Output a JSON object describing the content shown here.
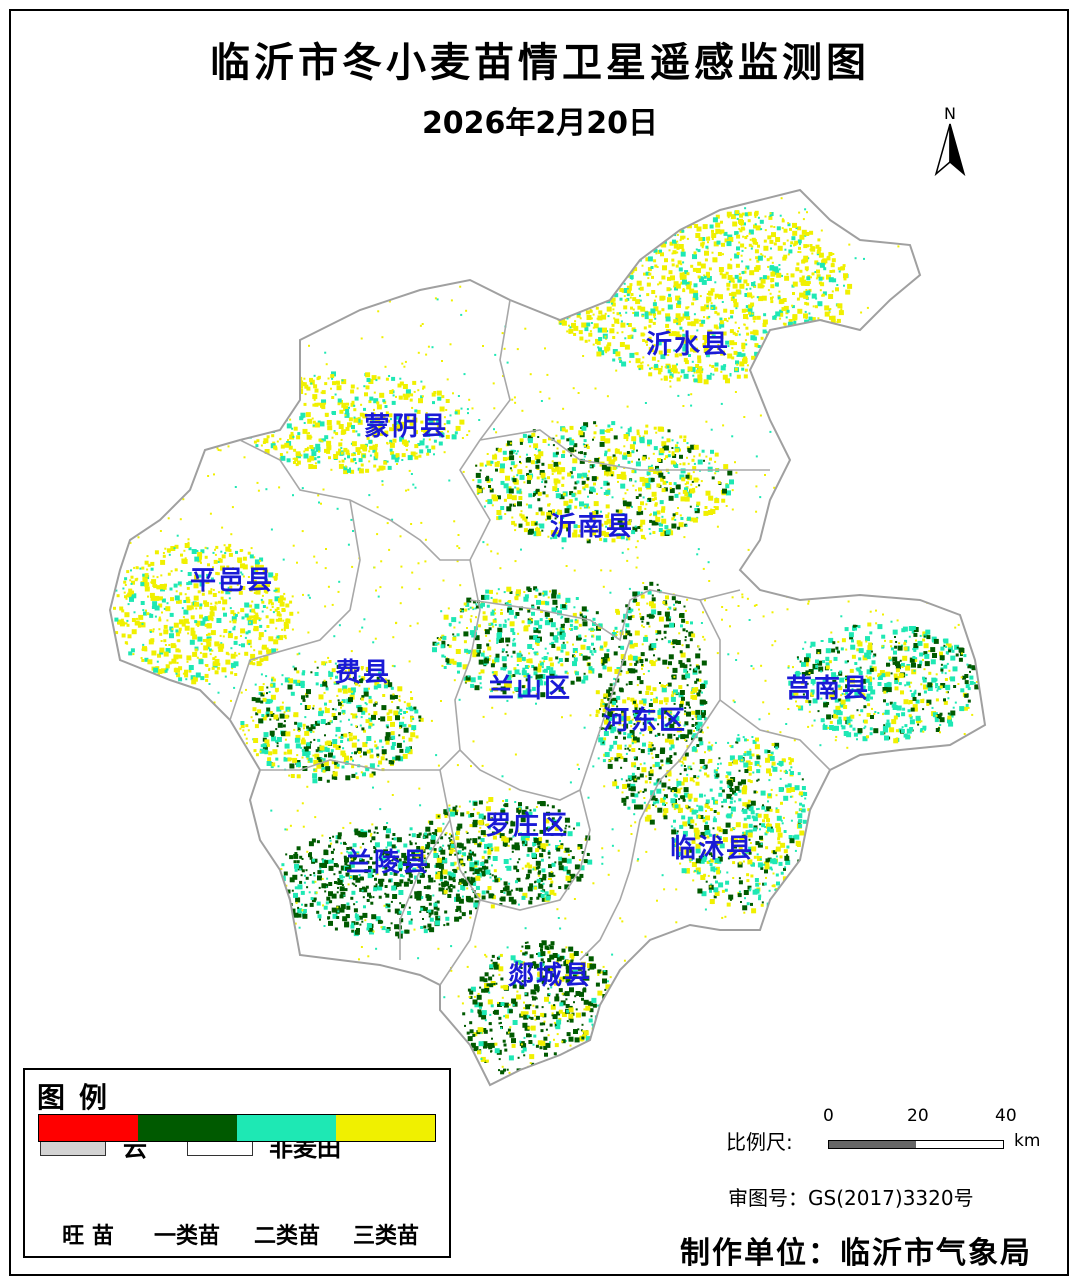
{
  "title": "临沂市冬小麦苗情卫星遥感监测图",
  "date": "2026年2月20日",
  "north_label": "N",
  "counties": [
    {
      "name": "沂水县"
    },
    {
      "name": "蒙阴县"
    },
    {
      "name": "沂南县"
    },
    {
      "name": "平邑县"
    },
    {
      "name": "费县"
    },
    {
      "name": "兰山区"
    },
    {
      "name": "莒南县"
    },
    {
      "name": "河东区"
    },
    {
      "name": "罗庄区"
    },
    {
      "name": "临沭县"
    },
    {
      "name": "兰陵县"
    },
    {
      "name": "郯城县"
    }
  ],
  "legend": {
    "title": "图例",
    "cloud_label": "云",
    "cloud_color": "#d3d3d3",
    "nonwheat_label": "非麦田",
    "nonwheat_color": "#ffffff",
    "classes": [
      {
        "label": "旺 苗",
        "color": "#ff0000"
      },
      {
        "label": "一类苗",
        "color": "#005a00"
      },
      {
        "label": "二类苗",
        "color": "#1ee8b4"
      },
      {
        "label": "三类苗",
        "color": "#f0f000"
      }
    ]
  },
  "scale": {
    "label": "比例尺:",
    "ticks": [
      "0",
      "20",
      "40"
    ],
    "unit": "km"
  },
  "review_number": "审图号：GS(2017)3320号",
  "producer": "制作单位：临沂市气象局"
}
